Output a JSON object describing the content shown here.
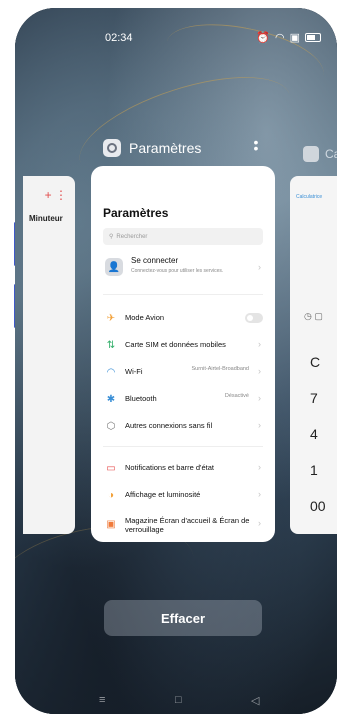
{
  "status": {
    "time": "02:34",
    "icons": [
      "alarm-icon",
      "wifi-icon",
      "nfc-icon",
      "battery-icon"
    ]
  },
  "recent_app": {
    "title": "Paramètres",
    "menu_icon": "more-vertical-icon"
  },
  "left_app": {
    "label": "Minuteur",
    "top_icons": "+  ⋮"
  },
  "right_app": {
    "title_prefix": "Ca",
    "tab_label": "Calculatrice",
    "keys": [
      "C",
      "7",
      "4",
      "1",
      "00"
    ]
  },
  "settings": {
    "title": "Paramètres",
    "search_placeholder": "Rechercher",
    "connect": {
      "title": "Se connecter",
      "subtitle": "Connectez-vous pour utiliser les services."
    },
    "rows": [
      {
        "label": "Mode Avion",
        "value": "",
        "icon": "airplane-icon"
      },
      {
        "label": "Carte SIM et données mobiles",
        "value": "",
        "icon": "sim-icon"
      },
      {
        "label": "Wi-Fi",
        "value": "Surnit-Airtel-Broadband",
        "icon": "wifi-icon"
      },
      {
        "label": "Bluetooth",
        "value": "Désactivé",
        "icon": "bluetooth-icon"
      },
      {
        "label": "Autres connexions sans fil",
        "value": "",
        "icon": "connections-icon"
      },
      {
        "label": "Notifications et barre d'état",
        "value": "",
        "icon": "notifications-icon"
      },
      {
        "label": "Affichage et luminosité",
        "value": "",
        "icon": "display-icon"
      },
      {
        "label": "Magazine Écran d'accueil & Écran de verrouillage",
        "value": "",
        "icon": "magazine-icon"
      }
    ]
  },
  "clear_button": "Effacer",
  "nav": {
    "menu": "≡",
    "home": "□",
    "back": "◁"
  },
  "colors": {
    "accent": "#3a8fd6",
    "airplane": "#f2a13a",
    "sim": "#35b06c",
    "wifi": "#3a8fd6",
    "bluetooth": "#3a8fd6",
    "notifications": "#e74c4c",
    "display": "#f2a13a",
    "magazine": "#f07a3a"
  }
}
